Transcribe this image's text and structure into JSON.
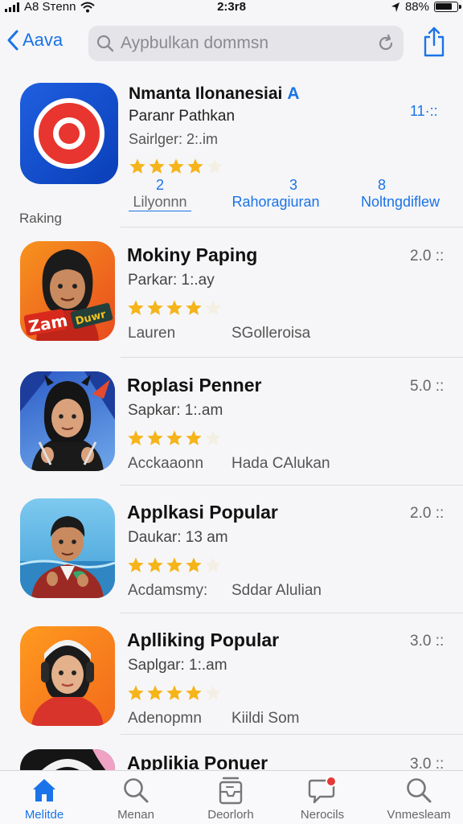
{
  "status_bar": {
    "carrier": "A8 Sтenn",
    "time": "2:3r8",
    "battery": "88%"
  },
  "nav": {
    "back_label": "Aava",
    "search_placeholder": "Aypbulkan dommsn"
  },
  "featured": {
    "title": "Nmanta Ilonanesiai",
    "badge": "A",
    "subtitle": "Paranr Pathkan",
    "size": "Sairlger: 2:.im",
    "price": "11·::",
    "rating": 4,
    "stats": [
      {
        "num": "2",
        "label": "Lilyonnn"
      },
      {
        "num": "3",
        "label": "Rahoragiuran"
      },
      {
        "num": "8",
        "label": "Noltngdiflew"
      }
    ],
    "ranking_label": "Raking"
  },
  "apps": [
    {
      "name": "Mokiny Paping",
      "sub": "Parkar: 1:.ay",
      "tag1": "Lauren",
      "tag2": "SGolleroisa",
      "value": "2.0 ::",
      "rating": 4
    },
    {
      "name": "Roplasi Penner",
      "sub": "Sapkar: 1:.am",
      "tag1": "Acckaaonn",
      "tag2": "Hada CAlukan",
      "value": "5.0 ::",
      "rating": 4
    },
    {
      "name": "Applkasi Popular",
      "sub": "Daukar: 13 am",
      "tag1": "Acdamsmy:",
      "tag2": "Sddar Alulian",
      "value": "2.0 ::",
      "rating": 4
    },
    {
      "name": "Aplliking Popular",
      "sub": "Saplgar: 1:.am",
      "tag1": "Adenopmn",
      "tag2": "Kiildi Som",
      "value": "3.0 ::",
      "rating": 4
    },
    {
      "name": "Applikia Ponuer",
      "sub": "",
      "tag1": "",
      "tag2": "",
      "value": "3.0 ::",
      "rating": 0
    }
  ],
  "tabs": [
    {
      "label": "Melitde",
      "icon": "home-icon",
      "active": true
    },
    {
      "label": "Menan",
      "icon": "search-icon",
      "active": false
    },
    {
      "label": "Deorlorh",
      "icon": "inbox-icon",
      "active": false
    },
    {
      "label": "Nerocils",
      "icon": "message-icon",
      "active": false
    },
    {
      "label": "Vnmesleam",
      "icon": "search-icon",
      "active": false
    }
  ],
  "colors": {
    "accent": "#1a73e8",
    "star": "#f5b41a",
    "notification": "#e53935"
  }
}
